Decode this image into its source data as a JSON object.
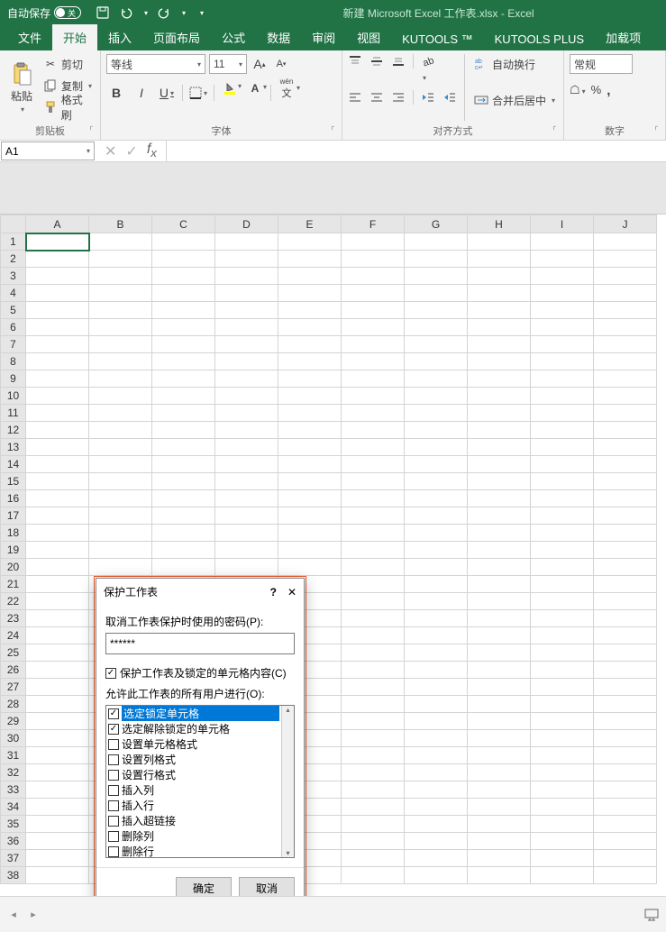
{
  "titlebar": {
    "autosave": "自动保存",
    "toggle_label": "关",
    "title": "新建 Microsoft Excel 工作表.xlsx  -  Excel"
  },
  "tabs": [
    "文件",
    "开始",
    "插入",
    "页面布局",
    "公式",
    "数据",
    "审阅",
    "视图",
    "KUTOOLS ™",
    "KUTOOLS PLUS",
    "加载项"
  ],
  "active_tab_index": 1,
  "ribbon": {
    "clipboard": {
      "paste": "粘贴",
      "cut": "剪切",
      "copy": "复制",
      "format_painter": "格式刷",
      "label": "剪贴板"
    },
    "font": {
      "name": "等线",
      "size": "11",
      "label": "字体",
      "bold": "B",
      "italic": "I",
      "underline": "U",
      "pinyin": "wén"
    },
    "alignment": {
      "wrap": "自动换行",
      "merge": "合并后居中",
      "label": "对齐方式"
    },
    "number": {
      "format": "常规",
      "label": "数字"
    }
  },
  "namebox": "A1",
  "columns": [
    "A",
    "B",
    "C",
    "D",
    "E",
    "F",
    "G",
    "H",
    "I",
    "J"
  ],
  "row_count": 38,
  "selected": {
    "row": 1,
    "col": "A"
  },
  "dialog": {
    "title": "保护工作表",
    "password_label": "取消工作表保护时使用的密码(P):",
    "password_value": "******",
    "protect_check": "保护工作表及锁定的单元格内容(C)",
    "protect_checked": true,
    "allow_label": "允许此工作表的所有用户进行(O):",
    "items": [
      {
        "label": "选定锁定单元格",
        "checked": true,
        "selected": true
      },
      {
        "label": "选定解除锁定的单元格",
        "checked": true
      },
      {
        "label": "设置单元格格式",
        "checked": false
      },
      {
        "label": "设置列格式",
        "checked": false
      },
      {
        "label": "设置行格式",
        "checked": false
      },
      {
        "label": "插入列",
        "checked": false
      },
      {
        "label": "插入行",
        "checked": false
      },
      {
        "label": "插入超链接",
        "checked": false
      },
      {
        "label": "删除列",
        "checked": false
      },
      {
        "label": "删除行",
        "checked": false
      }
    ],
    "ok": "确定",
    "cancel": "取消"
  }
}
